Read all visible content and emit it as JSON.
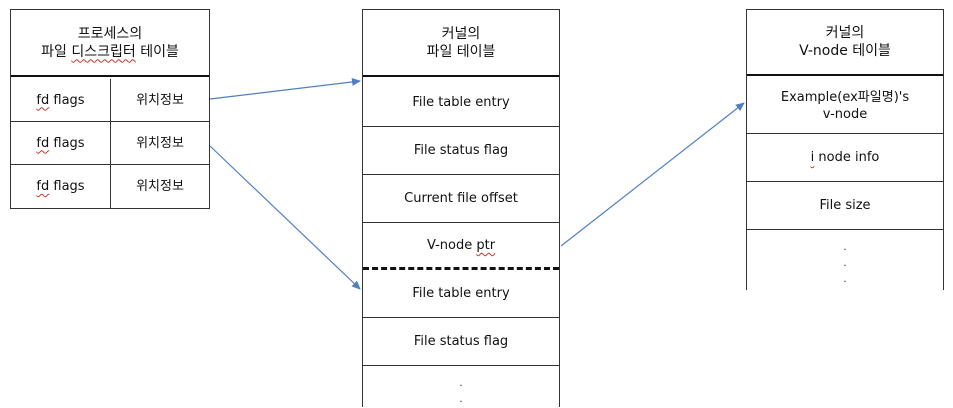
{
  "process_table": {
    "title_line1": "프로세스의",
    "title_line2_plain": "파일 ",
    "title_line2_squiggle": "디스크립터",
    "title_line2_end": " 테이블",
    "rows": [
      {
        "flags_underlined": "fd",
        "flags_rest": " flags",
        "position": "위치정보"
      },
      {
        "flags_underlined": "fd",
        "flags_rest": " flags",
        "position": "위치정보"
      },
      {
        "flags_underlined": "fd",
        "flags_rest": " flags",
        "position": "위치정보"
      }
    ]
  },
  "kernel_file_table": {
    "title_line1": "커널의",
    "title_line2": "파일 테이블",
    "entry1": {
      "file_table_entry": "File table entry",
      "file_status_flag": "File status flag",
      "current_file_offset": "Current file offset",
      "vnode_ptr_prefix": "V-node ",
      "vnode_ptr_underlined": "ptr"
    },
    "entry2": {
      "file_table_entry": "File table entry",
      "file_status_flag": "File status flag"
    },
    "continuation_dots": [
      ".",
      "."
    ]
  },
  "vnode_table": {
    "title_line1": "커널의",
    "title_line2": "V-node 테이블",
    "example_line1": "Example(ex파일명)'s",
    "example_line2": "v-node",
    "inode_underlined": "i",
    "inode_rest": " node info",
    "file_size": "File size",
    "continuation_dots": [
      ".",
      ".",
      "."
    ]
  },
  "colors": {
    "border": "#333333",
    "arrow": "#4f7fc1",
    "squiggle": "#c0392b"
  }
}
